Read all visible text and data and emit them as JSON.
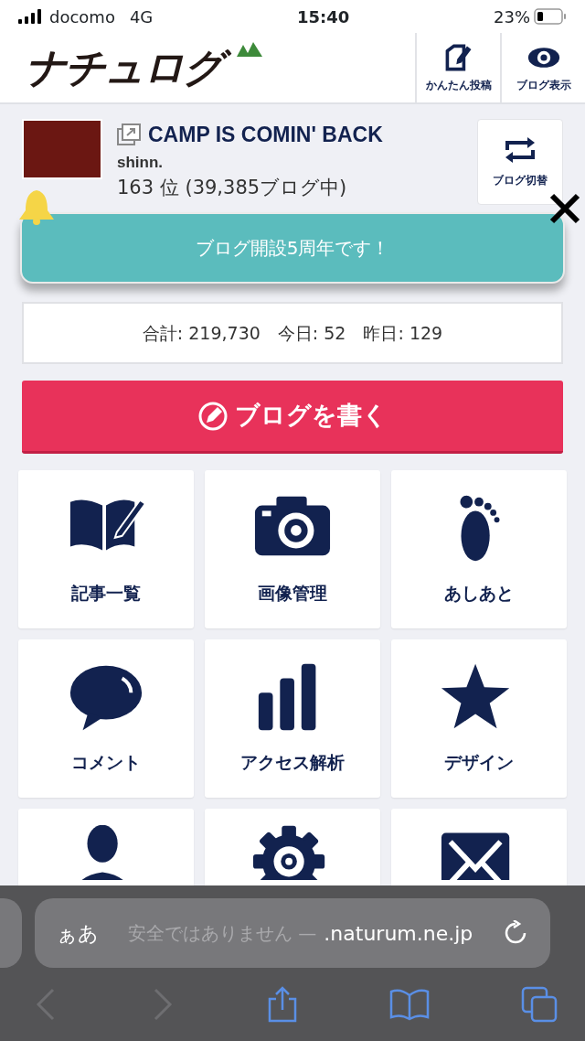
{
  "status_bar": {
    "carrier": "docomo",
    "network": "4G",
    "time": "15:40",
    "battery": "23%"
  },
  "header": {
    "logo": "ナチュログ",
    "actions": [
      "かんたん投稿",
      "ブログ表示"
    ]
  },
  "blog": {
    "title": "CAMP IS COMIN' BACK",
    "author": "shinn.",
    "rank": "163 位 (39,385ブログ中)",
    "switch_label": "ブログ切替"
  },
  "banner": {
    "text": "ブログ開設5周年です！"
  },
  "stats": {
    "text": "合計: 219,730　今日: 52　昨日: 129"
  },
  "write_button": {
    "label": "ブログを書く"
  },
  "tiles": [
    {
      "kind": "full",
      "label": "記事一覧"
    },
    {
      "kind": "full",
      "label": "画像管理"
    },
    {
      "kind": "full",
      "label": "あしあと"
    },
    {
      "kind": "full",
      "label": "コメント"
    },
    {
      "kind": "full",
      "label": "アクセス解析"
    },
    {
      "kind": "full",
      "label": "デザイン"
    },
    {
      "kind": "cut"
    },
    {
      "kind": "cut"
    },
    {
      "kind": "cut"
    }
  ],
  "browser": {
    "text_size": "ぁあ",
    "security": "安全ではありません —",
    "domain": ".naturum.ne.jp",
    "back_disabled": true,
    "forward_disabled": true
  }
}
